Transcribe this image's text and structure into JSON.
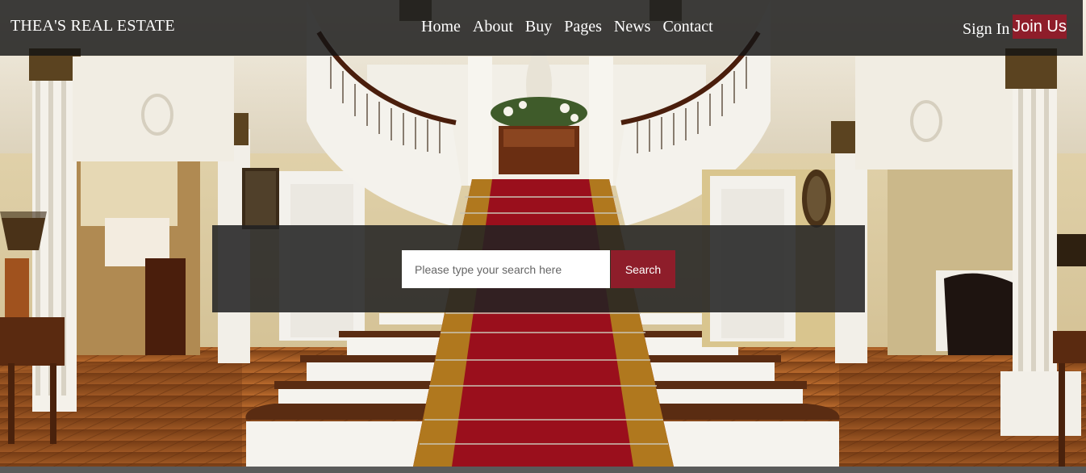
{
  "brand": {
    "name": "THEA'S REAL ESTATE"
  },
  "nav": {
    "items": [
      "Home",
      "About",
      "Buy",
      "Pages",
      "News",
      "Contact"
    ]
  },
  "auth": {
    "signin_label": "Sign In",
    "join_label": "Join Us"
  },
  "search": {
    "placeholder": "Please type your search here",
    "button_label": "Search"
  },
  "colors": {
    "accent": "#8e1d2a",
    "topbar": "#141414",
    "panel": "#232323"
  }
}
